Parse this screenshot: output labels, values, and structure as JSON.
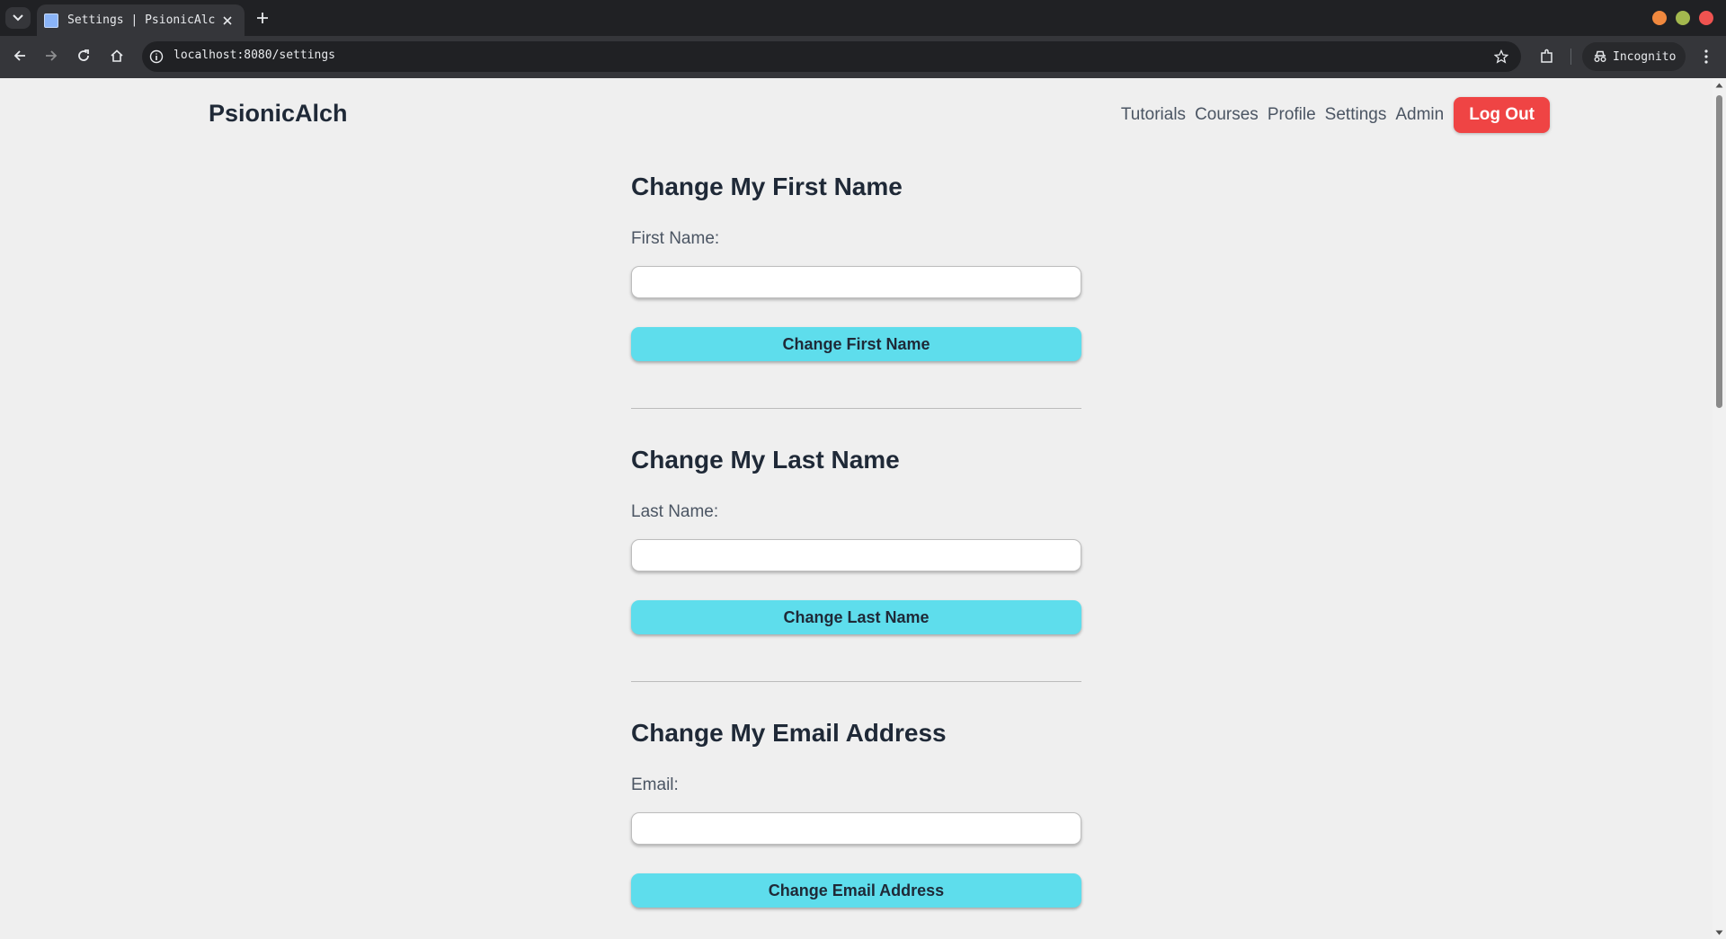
{
  "browser": {
    "tab_title": "Settings | PsionicAlch",
    "url": "localhost:8080/settings",
    "incognito_label": "Incognito",
    "window_controls": [
      "minimize",
      "maximize",
      "close"
    ],
    "icons": [
      "tab-list-icon",
      "favicon-icon",
      "close-tab-icon",
      "new-tab-icon",
      "back-icon",
      "forward-icon",
      "reload-icon",
      "home-icon",
      "site-info-icon",
      "bookmark-star-icon",
      "extensions-icon",
      "incognito-icon",
      "menu-icon"
    ]
  },
  "header": {
    "brand": "PsionicAlch",
    "nav": [
      {
        "label": "Tutorials"
      },
      {
        "label": "Courses"
      },
      {
        "label": "Profile"
      },
      {
        "label": "Settings"
      },
      {
        "label": "Admin"
      }
    ],
    "logout_label": "Log Out",
    "logout_color": "#ef4444"
  },
  "sections": [
    {
      "heading": "Change My First Name",
      "label": "First Name:",
      "value": "",
      "button": "Change First Name"
    },
    {
      "heading": "Change My Last Name",
      "label": "Last Name:",
      "value": "",
      "button": "Change Last Name"
    },
    {
      "heading": "Change My Email Address",
      "label": "Email:",
      "value": "",
      "button": "Change Email Address"
    }
  ],
  "colors": {
    "page_background": "#efefef",
    "primary_button": "#5eddec",
    "text_dark": "#1f2937"
  }
}
